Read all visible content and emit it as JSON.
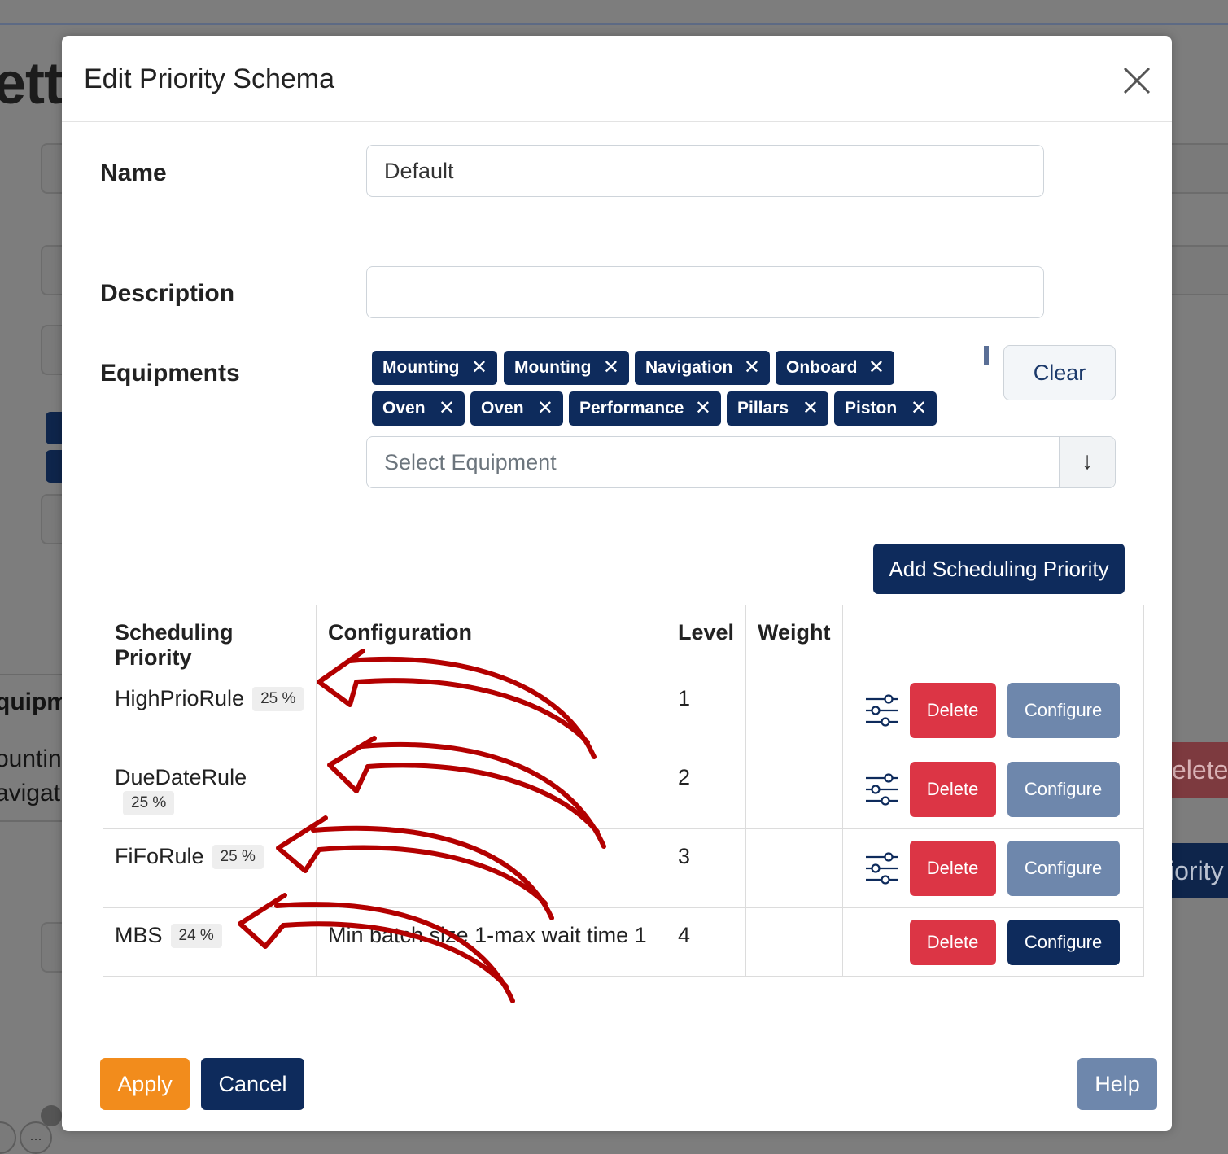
{
  "background": {
    "title_fragment": "ett",
    "label_equipment": "quipme",
    "label_mounting": "ountin",
    "label_navigation": "avigati",
    "delete_fragment": "elete",
    "priority_fragment": "iority",
    "more_dots": "..."
  },
  "modal": {
    "title": "Edit Priority Schema",
    "close_icon": "close-icon"
  },
  "form": {
    "name_label": "Name",
    "name_value": "Default",
    "description_label": "Description",
    "description_value": "",
    "equipments_label": "Equipments",
    "equipment_tags": [
      "Mounting",
      "Mounting",
      "Navigation",
      "Onboard",
      "Oven",
      "Oven",
      "Performance",
      "Pillars",
      "Piston"
    ],
    "tag_remove": "✕",
    "clear_label": "Clear",
    "select_placeholder": "Select Equipment",
    "select_arrow": "↓",
    "add_priority_label": "Add Scheduling Priority"
  },
  "table": {
    "headers": {
      "priority": "Scheduling Priority",
      "configuration": "Configuration",
      "level": "Level",
      "weight": "Weight"
    },
    "rows": [
      {
        "name": "HighPrioRule",
        "percent": "25 %",
        "configuration": "",
        "level": "1",
        "weight": "",
        "has_sliders": true,
        "delete": "Delete",
        "configure": "Configure"
      },
      {
        "name": "DueDateRule",
        "percent": "25 %",
        "configuration": "",
        "level": "2",
        "weight": "",
        "has_sliders": true,
        "delete": "Delete",
        "configure": "Configure"
      },
      {
        "name": "FiFoRule",
        "percent": "25 %",
        "configuration": "",
        "level": "3",
        "weight": "",
        "has_sliders": true,
        "delete": "Delete",
        "configure": "Configure"
      },
      {
        "name": "MBS",
        "percent": "24 %",
        "configuration": "Min batch size 1-max wait time 1",
        "level": "4",
        "weight": "",
        "has_sliders": false,
        "delete": "Delete",
        "configure": "Configure"
      }
    ]
  },
  "footer": {
    "apply_label": "Apply",
    "cancel_label": "Cancel",
    "help_label": "Help"
  },
  "colors": {
    "primary": "#0e2b5c",
    "danger": "#dc3545",
    "muted_button": "#6e87ac",
    "apply": "#f28c1c",
    "annotation_arrow": "#b30000"
  }
}
